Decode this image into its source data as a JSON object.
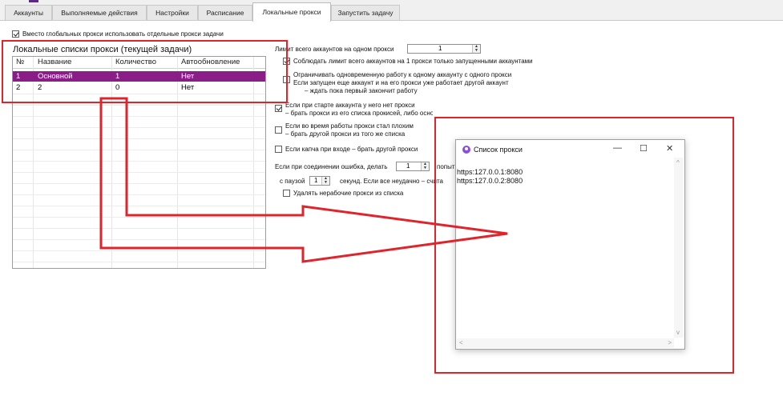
{
  "tabs": [
    {
      "label": "Аккаунты",
      "active": false
    },
    {
      "label": "Выполняемые действия",
      "active": false
    },
    {
      "label": "Настройки",
      "active": false
    },
    {
      "label": "Расписание",
      "active": false
    },
    {
      "label": "Локальные прокси",
      "active": true
    },
    {
      "label": "Запустить задачу",
      "active": false
    }
  ],
  "use_local_proxies": {
    "label": "Вместо глобальных прокси использовать отдельные прокси задачи",
    "checked": true
  },
  "grid": {
    "title": "Локальные списки прокси (текущей задачи)",
    "columns": [
      "№",
      "Название",
      "Количество",
      "Автообновление"
    ],
    "rows": [
      {
        "num": "1",
        "name": "Основной",
        "count": "1",
        "auto": "Нет",
        "selected": true
      },
      {
        "num": "2",
        "name": "2",
        "count": "0",
        "auto": "Нет",
        "selected": false
      }
    ]
  },
  "settings": {
    "limit_label": "Лимит всего аккаунтов на одном прокси",
    "limit_value": "1",
    "observe_limit": {
      "label": "Соблюдать лимит всего аккаунтов на 1 прокси только запущенными аккаунтами",
      "checked": true
    },
    "restrict_one": {
      "line1": "Ограничивать одновременную работу к одному аккаунту с одного прокси",
      "line2": "Если запущен еще аккаунт и на его прокси уже работает другой аккаунт",
      "line3": "– ждать пока первый закончит работу",
      "checked": false
    },
    "no_proxy_on_start": {
      "line1": "Если при старте аккаунта у него нет прокси",
      "line2": "– брать прокси из его списка прокисей, либо основного списка, если список не призначен",
      "checked": true
    },
    "bad_proxy": {
      "line1": "Если во время работы прокси стал плохим",
      "line2": "– брать другой прокси из того же списка",
      "checked": false
    },
    "captcha": {
      "label": "Если капча при входе – брать другой прокси",
      "checked": false
    },
    "conn_error_label": "Если при соединении ошибка, делать",
    "conn_error_value": "1",
    "conn_error_suffix": "попыт",
    "pause_label": "с паузой",
    "pause_value": "1",
    "pause_suffix": "секунд. Если все неудачно – счита",
    "remove_bad": {
      "label": "Удалять нерабочие прокси из списка",
      "checked": false
    }
  },
  "popup": {
    "title": "Список прокси",
    "minimize": "—",
    "maximize": "☐",
    "close": "✕",
    "items": [
      "https:127.0.0.1:8080",
      "https:127.0.0.2:8080"
    ],
    "accent_color": "#8a4fd8"
  },
  "annotation_color": "#e0242c",
  "selection_color": "#8a1d88"
}
